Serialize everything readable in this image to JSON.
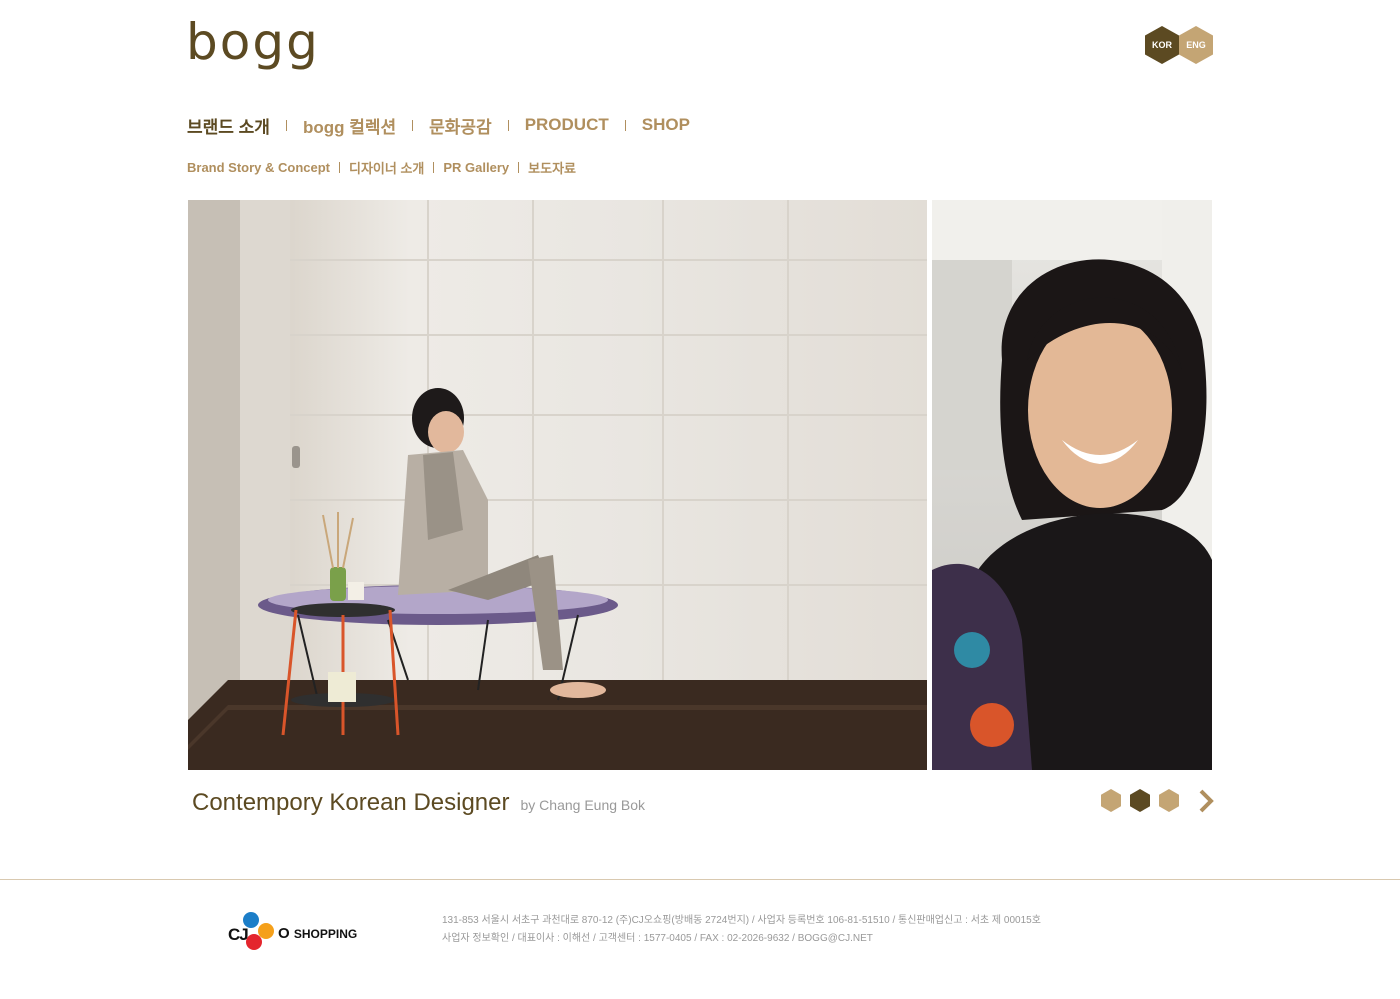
{
  "brand": {
    "logo": "bogg"
  },
  "lang": {
    "kor": "KOR",
    "eng": "ENG"
  },
  "colors": {
    "brand_dark": "#5c4a22",
    "brand_gold": "#b08f5e",
    "text_gray": "#999999"
  },
  "main_nav": [
    {
      "label": "브랜드 소개",
      "active": true
    },
    {
      "label": "bogg 컬렉션",
      "active": false
    },
    {
      "label": "문화공감",
      "active": false
    },
    {
      "label": "PRODUCT",
      "active": false
    },
    {
      "label": "SHOP",
      "active": false
    }
  ],
  "sub_nav": [
    {
      "label": "Brand Story & Concept"
    },
    {
      "label": "디자이너 소개"
    },
    {
      "label": "PR Gallery"
    },
    {
      "label": "보도자료"
    }
  ],
  "slide": {
    "title": "Contempory Korean Designer",
    "byline": "by Chang Eung Bok",
    "pager": {
      "total": 3,
      "active": 2
    },
    "next_icon": "chevron-right-icon"
  },
  "footer": {
    "logo": {
      "cj": "CJ",
      "o": "O",
      "shopping": "SHOPPING"
    },
    "line1": "131-853 서울시 서초구 과천대로 870-12 (주)CJ오쇼핑(방배동 2724번지) / 사업자 등록번호 106-81-51510 / 통신판매업신고 : 서초 제 00015호",
    "line2": "사업자 정보확인 / 대표이사 : 이해선 / 고객센터 : 1577-0405 / FAX : 02-2026-9632 / BOGG@CJ.NET"
  }
}
